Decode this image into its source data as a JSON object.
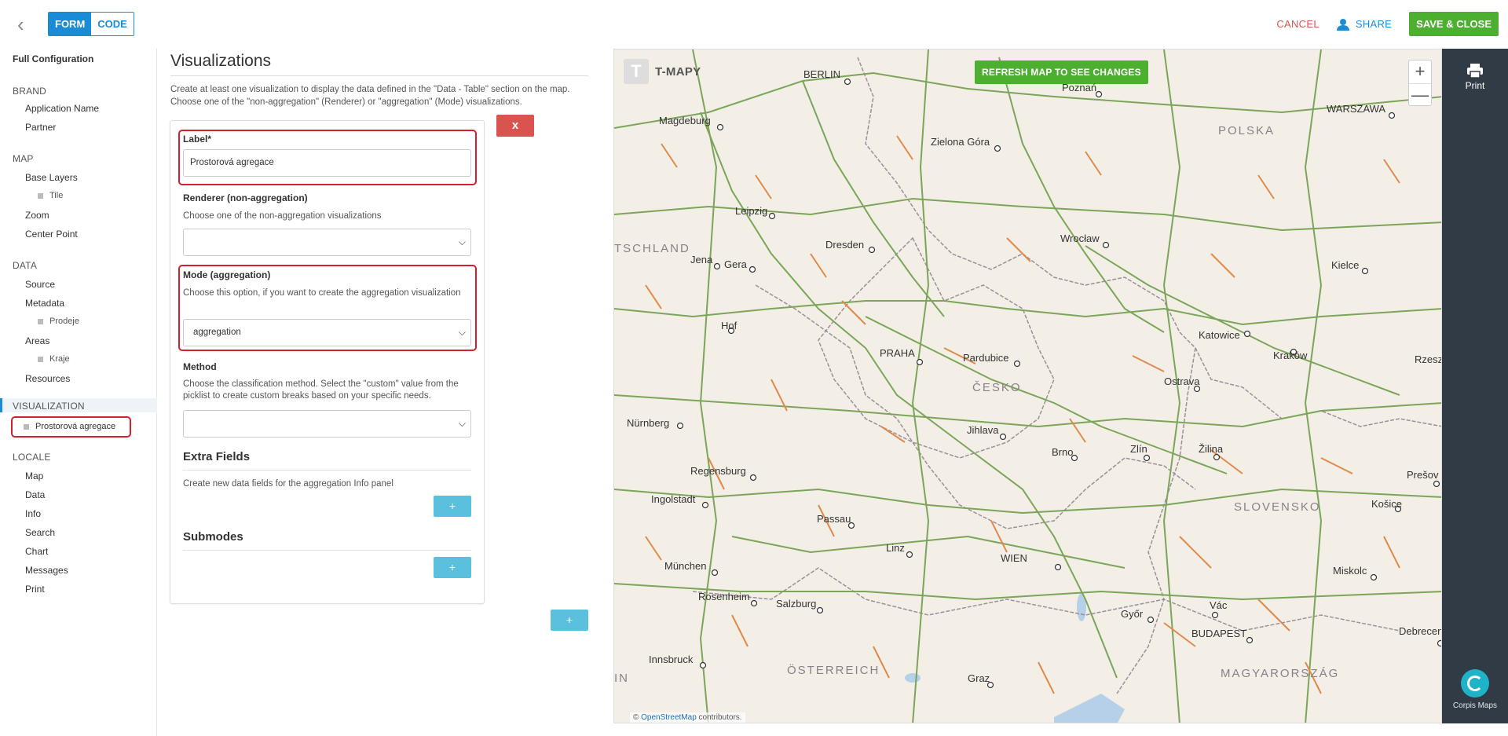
{
  "topbar": {
    "mode_form": "FORM",
    "mode_code": "CODE",
    "cancel": "CANCEL",
    "share": "SHARE",
    "save_close": "SAVE & CLOSE"
  },
  "nav": {
    "title": "Full Configuration",
    "brand": {
      "label": "BRAND",
      "items": [
        "Application Name",
        "Partner"
      ]
    },
    "map": {
      "label": "MAP",
      "base_layers": "Base Layers",
      "tile": "Tile",
      "zoom": "Zoom",
      "center_point": "Center Point"
    },
    "data": {
      "label": "DATA",
      "source": "Source",
      "metadata": "Metadata",
      "prodeje": "Prodeje",
      "areas": "Areas",
      "kraje": "Kraje",
      "resources": "Resources"
    },
    "visualization": {
      "label": "VISUALIZATION",
      "selected": "Prostorová agregace"
    },
    "locale": {
      "label": "LOCALE",
      "items": [
        "Map",
        "Data",
        "Info",
        "Search",
        "Chart",
        "Messages",
        "Print"
      ]
    }
  },
  "form": {
    "heading": "Visualizations",
    "intro_line1": "Create at least one visualization to display the data defined in the \"Data - Table\" section on the map.",
    "intro_line2": "Choose one of the \"non-aggregation\" (Renderer) or \"aggregation\" (Mode) visualizations.",
    "remove_label": "x",
    "label_field": {
      "label": "Label*",
      "value": "Prostorová agregace"
    },
    "renderer": {
      "label": "Renderer (non-aggregation)",
      "help": "Choose one of the non-aggregation visualizations",
      "value": ""
    },
    "mode": {
      "label": "Mode (aggregation)",
      "help": "Choose this option, if you want to create the aggregation visualization",
      "value": "aggregation"
    },
    "method": {
      "label": "Method",
      "help": "Choose the classification method. Select the \"custom\" value from the picklist to create custom breaks based on your specific needs.",
      "value": ""
    },
    "extra_fields": {
      "heading": "Extra Fields",
      "help": "Create new data fields for the aggregation Info panel",
      "add": "+"
    },
    "submodes": {
      "heading": "Submodes",
      "add": "+"
    },
    "add_visualization": "+"
  },
  "map": {
    "refresh": "REFRESH MAP TO SEE CHANGES",
    "logo_letter": "T",
    "logo_text": "T-MAPY",
    "zoom_in": "+",
    "zoom_out": "—",
    "attribution_prefix": "©",
    "attribution_link": "OpenStreetMap",
    "attribution_suffix": "contributors.",
    "cities": [
      "BERLIN",
      "Poznań",
      "WARSZAWA",
      "Magdeburg",
      "Zielona Góra",
      "Leipzig",
      "Wrocław",
      "Dresden",
      "Jena",
      "Gera",
      "Kielce",
      "Hof",
      "Katowice",
      "Kraków",
      "Rzesz",
      "PRAHA",
      "Pardubice",
      "Ostrava",
      "Nürnberg",
      "Jihlava",
      "Brno",
      "Zlín",
      "Žilina",
      "Regensburg",
      "Prešov",
      "Košice",
      "Ingolstadt",
      "Passau",
      "Linz",
      "WIEN",
      "München",
      "Rosenheim",
      "Salzburg",
      "Miskolc",
      "Győr",
      "Vác",
      "BUDAPEST",
      "Debrecen",
      "Innsbruck",
      "Graz"
    ],
    "countries": [
      "POLSKA",
      "TSCHLAND",
      "ČESKO",
      "SLOVENSKO",
      "ÖSTERREICH",
      "MAGYARORSZÁG",
      "IN"
    ]
  },
  "rail": {
    "print": "Print",
    "brand": "Corpis Maps"
  },
  "colors": {
    "accent": "#1a8bd6",
    "success": "#4caf2f",
    "danger": "#d9534f",
    "highlight": "#d41f2f",
    "info": "#5bc0de",
    "rail": "#313b45"
  }
}
